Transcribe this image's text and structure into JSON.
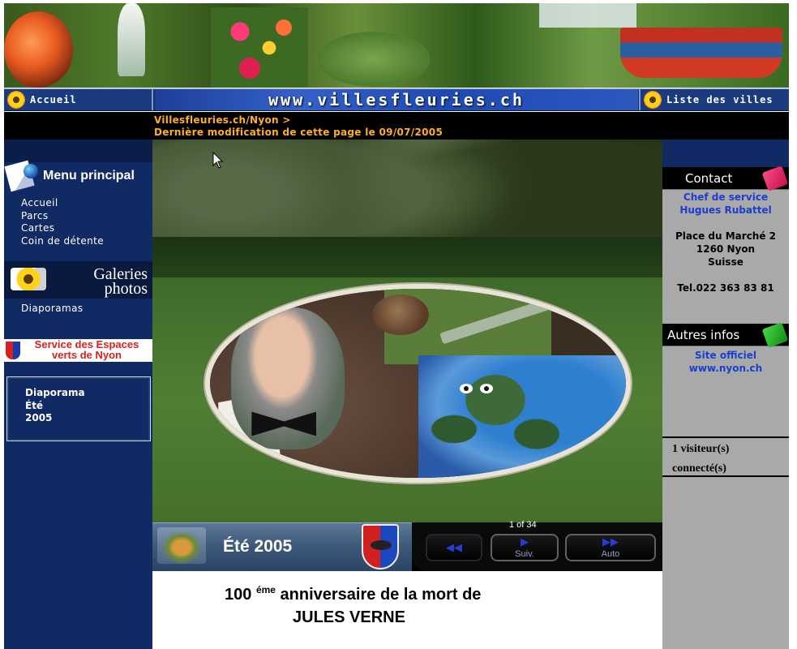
{
  "header": {
    "site_url": "www.villesfleuries.ch",
    "nav_home": "Accueil",
    "nav_cities": "Liste des villes"
  },
  "breadcrumb": {
    "path": "Villesfleuries.ch/Nyon",
    "separator": ">",
    "last_modified": "Dernière modification de cette page le 09/07/2005"
  },
  "sidebar": {
    "menu_title": "Menu principal",
    "menu_items": [
      "Accueil",
      "Parcs",
      "Cartes",
      "Coin de détente"
    ],
    "galleries_title_line1": "Galeries",
    "galleries_title_line2": "photos",
    "galleries_link": "Diaporamas",
    "service_line1": "Service des Espaces",
    "service_line2": "verts de Nyon",
    "diaporama_line1": "Diaporama",
    "diaporama_line2": "Été",
    "diaporama_line3": "2005"
  },
  "slideshow": {
    "title": "Été 2005",
    "counter": "1 of 34",
    "prev_icon": "rewind-icon",
    "next_label": "Suiv.",
    "auto_label": "Auto",
    "caption_line1_number": "100",
    "caption_line1_sup": "éme",
    "caption_line1_rest": "anniversaire de la mort de",
    "caption_line2": "JULES VERNE"
  },
  "contact": {
    "heading": "Contact",
    "role": "Chef de service",
    "name": "Hugues Rubattel",
    "address_line1": "Place du Marché 2",
    "address_line2": "1260 Nyon",
    "address_line3": "Suisse",
    "tel": "Tel.022 363 83 81"
  },
  "other_info": {
    "heading": "Autres infos",
    "link_line1": "Site officiel",
    "link_line2": "www.nyon.ch"
  },
  "visitors": {
    "line1": "1 visiteur(s)",
    "line2": "connecté(s)"
  },
  "colors": {
    "nav_blue": "#16306a",
    "sidebar_blue": "#102a63",
    "breadcrumb_orange": "#ffb020",
    "right_gray": "#a9a9a9",
    "link_blue": "#1a3fd0"
  }
}
